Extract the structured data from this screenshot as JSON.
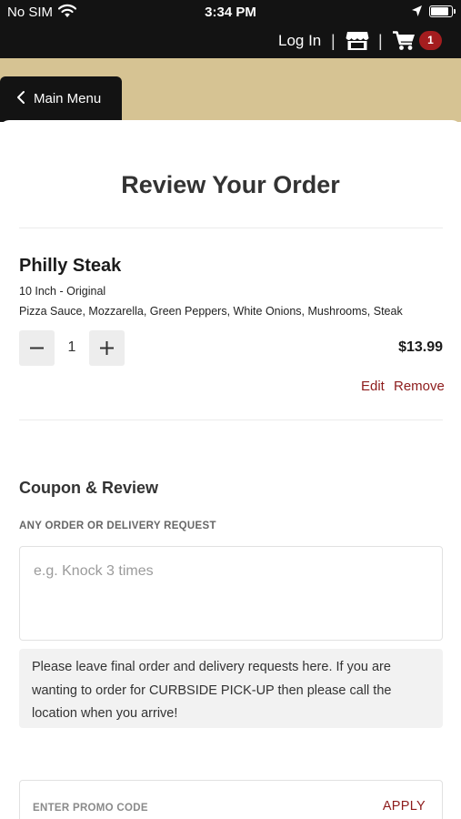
{
  "status_bar": {
    "carrier": "No SIM",
    "time": "3:34 PM",
    "battery_level": 0.9
  },
  "header": {
    "login_label": "Log In",
    "separator": "|",
    "cart_count": "1"
  },
  "nav": {
    "back_label": "Main Menu"
  },
  "page": {
    "title": "Review Your Order"
  },
  "order_item": {
    "name": "Philly Steak",
    "size": "10 Inch - Original",
    "toppings": "Pizza Sauce, Mozzarella, Green Peppers, White Onions, Mushrooms, Steak",
    "quantity": "1",
    "price": "$13.99",
    "edit_label": "Edit",
    "remove_label": "Remove"
  },
  "coupon_review": {
    "title": "Coupon & Review",
    "request_label": "ANY ORDER OR DELIVERY REQUEST",
    "request_placeholder": "e.g. Knock 3 times",
    "request_value": "",
    "note": "Please leave final order and delivery requests here. If you are wanting to order for CURBSIDE PICK-UP then please call the location when you arrive!",
    "promo_placeholder": "ENTER PROMO CODE",
    "apply_label": "APPLY"
  },
  "colors": {
    "header_bg": "#131313",
    "band_tan": "#d6c393",
    "accent_red": "#8d1b1b",
    "badge_red": "#a41d1f"
  },
  "icons": [
    "wifi-icon",
    "location-arrow-icon",
    "battery-icon",
    "store-icon",
    "cart-icon",
    "chevron-left-icon",
    "minus-icon",
    "plus-icon"
  ]
}
